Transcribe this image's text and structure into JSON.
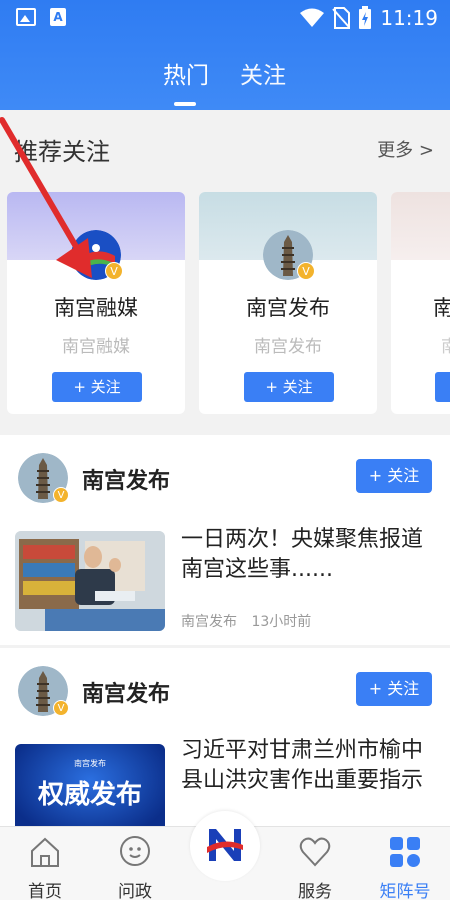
{
  "status_bar": {
    "time": "11:19"
  },
  "tabs": {
    "hot": "热门",
    "follow": "关注"
  },
  "recommend": {
    "title": "推荐关注",
    "more": "更多 >",
    "cards": [
      {
        "name": "南宫融媒",
        "subtitle": "南宫融媒",
        "follow": "+ 关注"
      },
      {
        "name": "南宫发布",
        "subtitle": "南宫发布",
        "follow": "+ 关注"
      },
      {
        "name": "南",
        "subtitle": "南",
        "follow": ""
      }
    ]
  },
  "feed": [
    {
      "author": "南宫发布",
      "follow": "+ 关注",
      "title": "一日两次！央媒聚焦报道南宫这些事......",
      "source": "南宫发布",
      "time": "13小时前"
    },
    {
      "author": "南宫发布",
      "follow": "+ 关注",
      "title": "习近平对甘肃兰州市榆中县山洪灾害作出重要指示",
      "thumb_top": "南宫发布",
      "thumb_main": "权威发布"
    }
  ],
  "verified_badge": "V",
  "bottom_nav": {
    "home": "首页",
    "ask": "问政",
    "service": "服务",
    "matrix": "矩阵号"
  },
  "colors": {
    "primary": "#3a7ff5",
    "header": "#2f7cf2",
    "badge": "#f3b32d"
  }
}
